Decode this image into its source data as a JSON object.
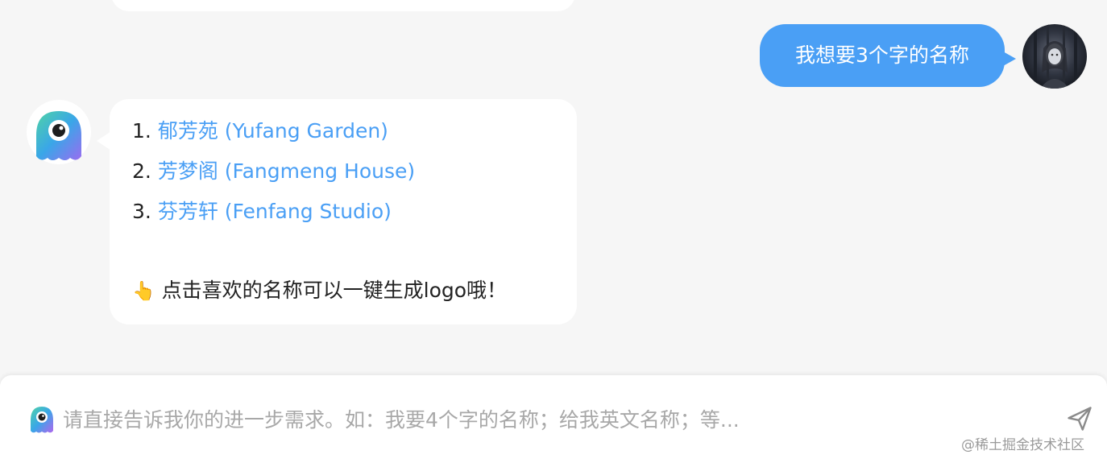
{
  "chat": {
    "user_message": "我想要3个字的名称",
    "bot_reply": {
      "names": [
        {
          "number": "1.",
          "label": "郁芳苑 (Yufang Garden)"
        },
        {
          "number": "2.",
          "label": "芳梦阁 (Fangmeng House)"
        },
        {
          "number": "3.",
          "label": "芬芳轩 (Fenfang Studio)"
        }
      ],
      "tip_emoji": "👆",
      "tip_text": "点击喜欢的名称可以一键生成logo哦！"
    }
  },
  "input": {
    "placeholder": "请直接告诉我你的进一步需求。如：我要4个字的名称；给我英文名称；等...",
    "value": ""
  },
  "watermark": "@稀土掘金技术社区",
  "colors": {
    "background": "#f6f6f6",
    "user_bubble": "#4a9ff5",
    "link": "#4a9ff5",
    "placeholder": "#a8a8a8"
  },
  "icons": {
    "bot_avatar": "ghost-mascot-icon",
    "input_icon": "ghost-mascot-icon",
    "send": "send-icon"
  }
}
